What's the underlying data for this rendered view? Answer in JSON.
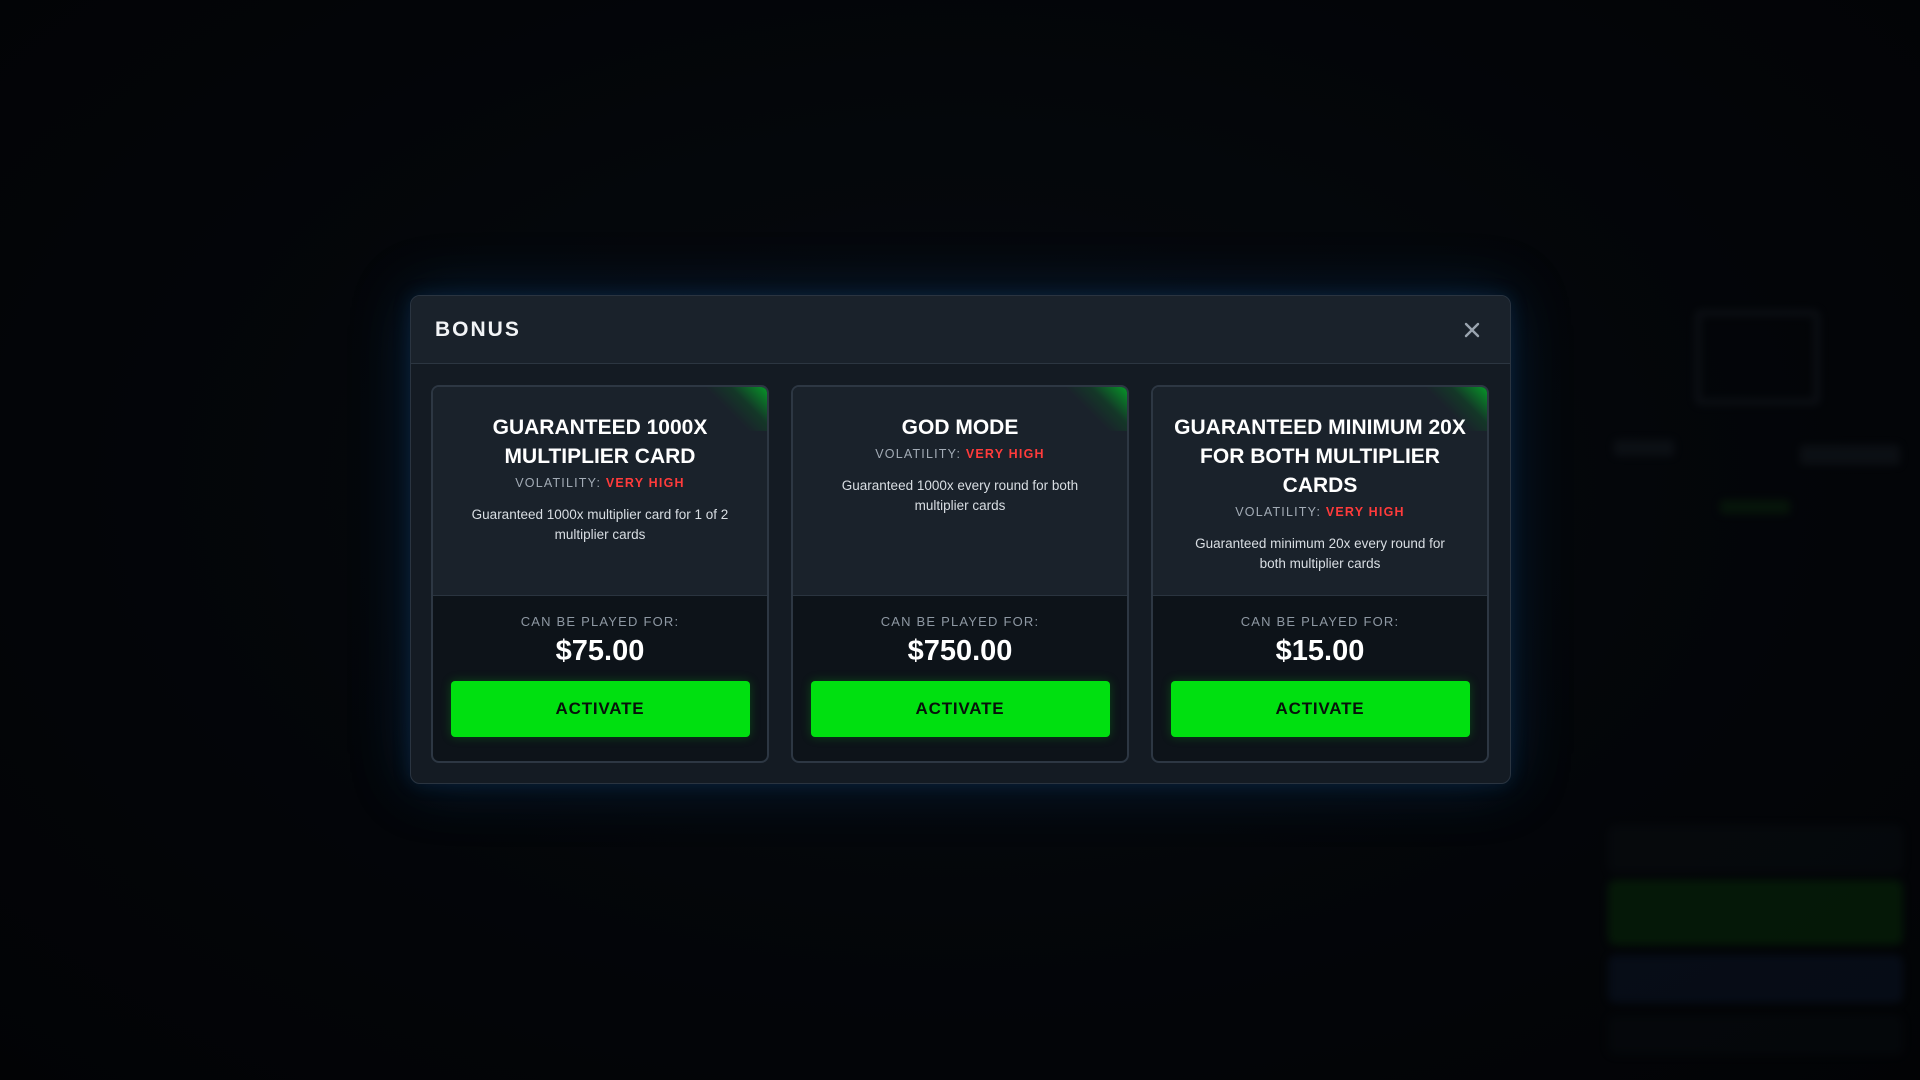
{
  "modal": {
    "title": "BONUS",
    "close_icon": "close-icon"
  },
  "cards": [
    {
      "title": "GUARANTEED 1000X MULTIPLIER CARD",
      "volatility_label": "VOLATILITY:",
      "volatility_value": "VERY HIGH",
      "description": "Guaranteed 1000x multiplier card for 1 of 2 multiplier cards",
      "played_for_label": "CAN BE PLAYED FOR:",
      "price": "$75.00",
      "button_label": "ACTIVATE"
    },
    {
      "title": "GOD MODE",
      "volatility_label": "VOLATILITY:",
      "volatility_value": "VERY HIGH",
      "description": "Guaranteed 1000x every round for both multiplier cards",
      "played_for_label": "CAN BE PLAYED FOR:",
      "price": "$750.00",
      "button_label": "ACTIVATE"
    },
    {
      "title": "GUARANTEED MINIMUM 20X FOR BOTH MULTIPLIER CARDS",
      "volatility_label": "VOLATILITY:",
      "volatility_value": "VERY HIGH",
      "description": "Guaranteed minimum 20x every round for both multiplier cards",
      "played_for_label": "CAN BE PLAYED FOR:",
      "price": "$15.00",
      "button_label": "ACTIVATE"
    }
  ],
  "colors": {
    "accent_green": "#00e010",
    "volatility_red": "#ff3b3b",
    "modal_bg": "#141b23",
    "card_top_bg": "#1a222b"
  }
}
